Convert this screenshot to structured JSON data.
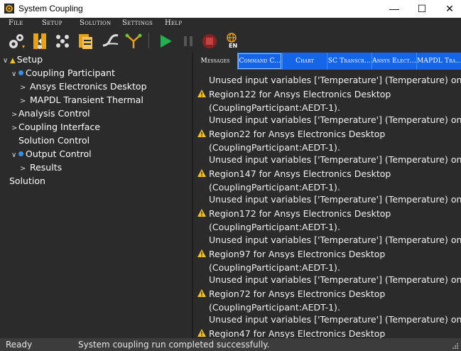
{
  "window": {
    "title": "System Coupling",
    "minimize": "—",
    "maximize": "☐",
    "close": "✕"
  },
  "menu": [
    {
      "label": "File"
    },
    {
      "label": "Setup"
    },
    {
      "label": "Solution"
    },
    {
      "label": "Settings"
    },
    {
      "label": "Help"
    }
  ],
  "toolbar": {
    "language_label": "EN",
    "colors": {
      "play": "#22b14c",
      "stop": "#d93a3a",
      "accent": "#e8a21a"
    }
  },
  "tree": [
    {
      "label": "Setup",
      "expander": "∨",
      "marker": "warn"
    },
    {
      "label": "Coupling Participant",
      "expander": "∨",
      "marker": "dot"
    },
    {
      "label": "Ansys Electronics Desktop",
      "expander": ">"
    },
    {
      "label": "MAPDL Transient Thermal",
      "expander": ">"
    },
    {
      "label": "Analysis Control",
      "expander": ">"
    },
    {
      "label": "Coupling Interface",
      "expander": ">"
    },
    {
      "label": "Solution Control",
      "expander": ""
    },
    {
      "label": "Output Control",
      "expander": "∨",
      "marker": "dot"
    },
    {
      "label": "Results",
      "expander": ">"
    },
    {
      "label": "Solution",
      "expander": ""
    }
  ],
  "tabs": [
    {
      "label": "Messages"
    },
    {
      "label": "Command C..."
    },
    {
      "label": "Chart"
    },
    {
      "label": "SC Transcr..."
    },
    {
      "label": "Ansys Elect..."
    },
    {
      "label": "MAPDL Tra..."
    }
  ],
  "messages": [
    {
      "line1": "Unused input variables ['Temperature'] (Temperature) on region",
      "line2": "Region122 for Ansys Electronics Desktop",
      "line3": "(CouplingParticipant:AEDT-1)."
    },
    {
      "line1": "Unused input variables ['Temperature'] (Temperature) on region",
      "line2": "Region22 for Ansys Electronics Desktop",
      "line3": "(CouplingParticipant:AEDT-1)."
    },
    {
      "line1": "Unused input variables ['Temperature'] (Temperature) on region",
      "line2": "Region147 for Ansys Electronics Desktop",
      "line3": "(CouplingParticipant:AEDT-1)."
    },
    {
      "line1": "Unused input variables ['Temperature'] (Temperature) on region",
      "line2": "Region172 for Ansys Electronics Desktop",
      "line3": "(CouplingParticipant:AEDT-1)."
    },
    {
      "line1": "Unused input variables ['Temperature'] (Temperature) on region",
      "line2": "Region97 for Ansys Electronics Desktop",
      "line3": "(CouplingParticipant:AEDT-1)."
    },
    {
      "line1": "Unused input variables ['Temperature'] (Temperature) on region",
      "line2": "Region72 for Ansys Electronics Desktop",
      "line3": "(CouplingParticipant:AEDT-1)."
    },
    {
      "line1": "Unused input variables ['Temperature'] (Temperature) on region",
      "line2": "Region47 for Ansys Electronics Desktop",
      "line3": ""
    }
  ],
  "status": {
    "state": "Ready",
    "message": "System coupling run completed successfully."
  }
}
